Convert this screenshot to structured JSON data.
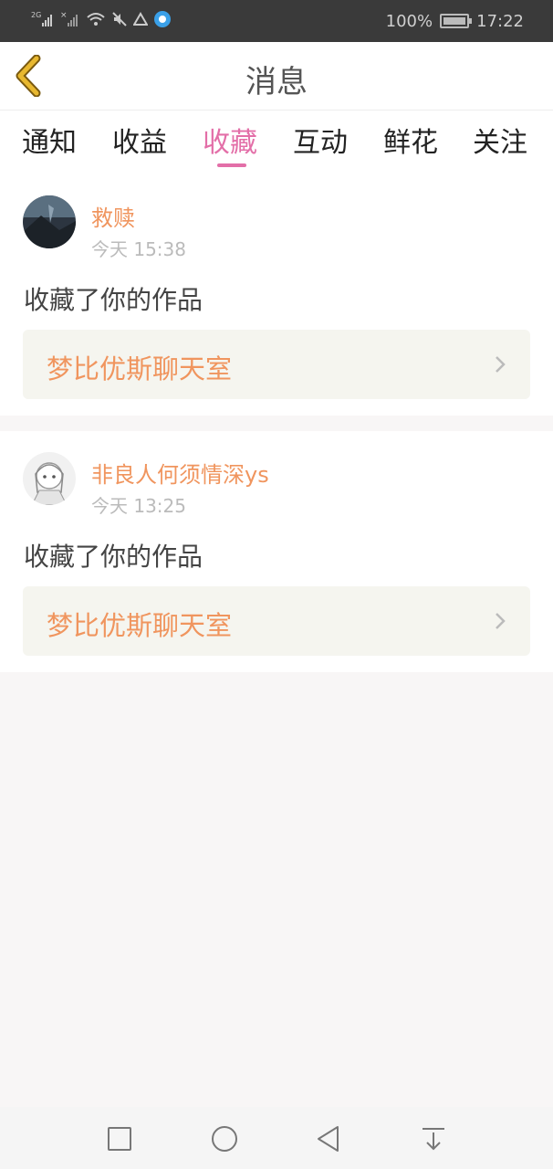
{
  "status_bar": {
    "signal_labels": [
      "2G",
      "×"
    ],
    "battery_percent": "100%",
    "time": "17:22"
  },
  "header": {
    "title": "消息"
  },
  "tabs": [
    {
      "label": "通知"
    },
    {
      "label": "收益"
    },
    {
      "label": "收藏",
      "active": true
    },
    {
      "label": "互动"
    },
    {
      "label": "鲜花"
    },
    {
      "label": "关注"
    }
  ],
  "messages": [
    {
      "username": "救赎",
      "time": "今天 15:38",
      "action": "收藏了你的作品",
      "work_title": "梦比优斯聊天室"
    },
    {
      "username": "非良人何须情深ys",
      "time": "今天 13:25",
      "action": "收藏了你的作品",
      "work_title": "梦比优斯聊天室"
    }
  ],
  "colors": {
    "accent": "#e36fa8",
    "username": "#f0955e",
    "back_arrow": "#e8b830"
  },
  "icons": {
    "back": "back-arrow-icon",
    "chevron": "chevron-right-icon",
    "nav": [
      "square-icon",
      "circle-icon",
      "triangle-back-icon",
      "download-icon"
    ]
  }
}
